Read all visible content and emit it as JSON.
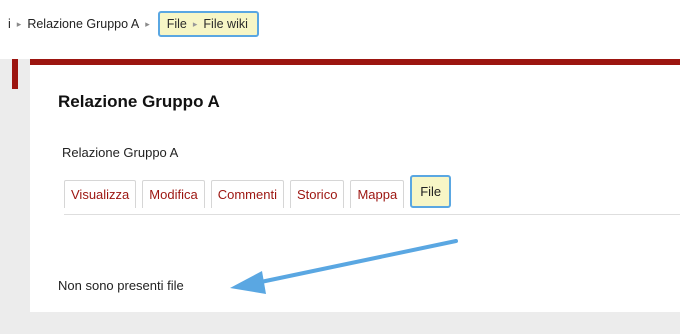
{
  "breadcrumb": {
    "prefix": "i",
    "separator": "▸",
    "wiki_name": "Relazione Gruppo A",
    "highlighted": {
      "section": "File",
      "current": "File wiki"
    }
  },
  "page": {
    "title": "Relazione Gruppo A",
    "subtitle": "Relazione Gruppo A"
  },
  "tabs": [
    {
      "label": "Visualizza",
      "active": false
    },
    {
      "label": "Modifica",
      "active": false
    },
    {
      "label": "Commenti",
      "active": false
    },
    {
      "label": "Storico",
      "active": false
    },
    {
      "label": "Mappa",
      "active": false
    },
    {
      "label": "File",
      "active": true
    }
  ],
  "content": {
    "empty_message": "Non sono presenti file"
  },
  "colors": {
    "accent_red": "#9c1510",
    "highlight_fill": "#f7f6c6",
    "highlight_border": "#5aa7e2",
    "arrow": "#5aa7e2"
  },
  "icons": {
    "breadcrumb_separator": "triangle-right-icon",
    "annotation": "arrow-icon"
  }
}
